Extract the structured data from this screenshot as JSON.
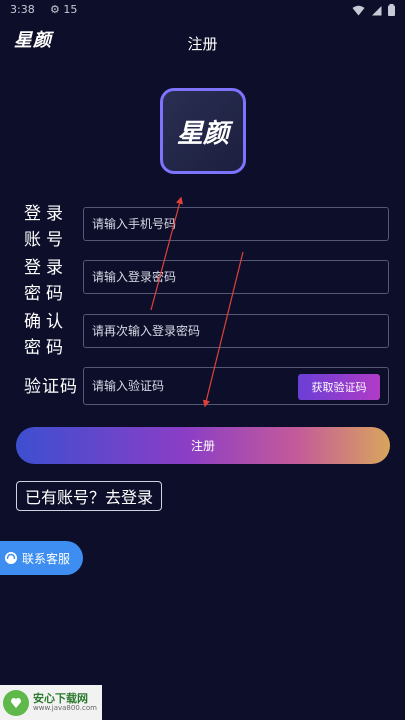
{
  "status_bar": {
    "time": "3:38",
    "extra": "⚙ 15"
  },
  "header": {
    "app_logo": "星颜",
    "title": "注册"
  },
  "logo": {
    "text": "星颜"
  },
  "form": {
    "account": {
      "label": "登录账号",
      "placeholder": "请输入手机号码"
    },
    "password": {
      "label": "登录密码",
      "placeholder": "请输入登录密码"
    },
    "confirm": {
      "label": "确认密码",
      "placeholder": "请再次输入登录密码"
    },
    "code": {
      "label": "验证码",
      "placeholder": "请输入验证码",
      "button": "获取验证码"
    }
  },
  "actions": {
    "register": "注册",
    "login_link": "已有账号？去登录",
    "customer_service": "联系客服"
  },
  "watermark": {
    "title": "安心下载网",
    "sub": "www.java800.com"
  },
  "colors": {
    "background": "#0d0f2a",
    "accent": "#7d73ff",
    "service": "#3d8ef0"
  }
}
